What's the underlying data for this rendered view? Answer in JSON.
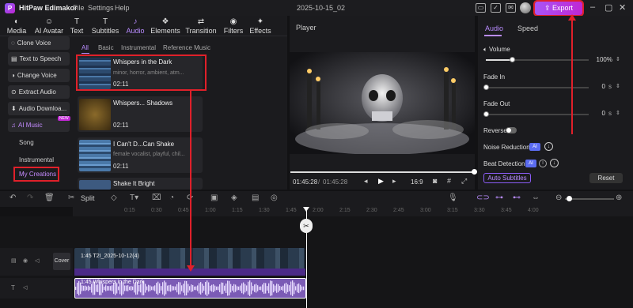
{
  "app": {
    "name": "HitPaw Edimakor",
    "menu": [
      "File",
      "Settings",
      "Help"
    ],
    "project_name": "2025-10-15_02",
    "export_label": "Export"
  },
  "top_tabs": [
    {
      "label": "Media",
      "icon": "◐"
    },
    {
      "label": "AI Avatar",
      "icon": "☺"
    },
    {
      "label": "Text",
      "icon": "T"
    },
    {
      "label": "Subtitles",
      "icon": "T"
    },
    {
      "label": "Audio",
      "icon": "♪"
    },
    {
      "label": "Elements",
      "icon": "❖"
    },
    {
      "label": "Transition",
      "icon": "⇄"
    },
    {
      "label": "Filters",
      "icon": "◉"
    },
    {
      "label": "Effects",
      "icon": "✦"
    }
  ],
  "sidebar": {
    "items": [
      "Clone Voice",
      "Text to Speech",
      "Change Voice",
      "Extract Audio",
      "Audio Downloa...",
      "AI Music"
    ],
    "ai_badge": "NEW",
    "subitems": [
      "Song",
      "Instrumental",
      "My Creations"
    ]
  },
  "filter_tabs": [
    "All",
    "Basic",
    "Instrumental",
    "Reference Music"
  ],
  "music_cards": [
    {
      "title": "Whispers in the Dark",
      "tags": "minor, horror, ambient, atm...",
      "duration": "02:11"
    },
    {
      "title": "Whispers... Shadows",
      "tags": "",
      "duration": "02:11"
    },
    {
      "title": "I Can't D...Can Shake",
      "tags": "female vocalist, playful, chil...",
      "duration": "02:11"
    },
    {
      "title": "Shake It Bright",
      "tags": "",
      "duration": ""
    }
  ],
  "player": {
    "label": "Player",
    "current": "01:45:28",
    "total": "01:45:28",
    "ratio": "16:9",
    "progress": 1.0
  },
  "right_panel": {
    "tabs": [
      "Audio",
      "Speed"
    ],
    "volume_label": "Volume",
    "volume_value": "100%",
    "volume_level": 0.25,
    "fade_in_label": "Fade In",
    "fade_in_value": "0",
    "fade_unit": "s",
    "fade_out_label": "Fade Out",
    "fade_out_value": "0",
    "reverse_label": "Reverse",
    "noise_label": "Noise Reduction",
    "beat_label": "Beat Detection",
    "ai_label": "AI",
    "auto_subtitles": "Auto Subtitles",
    "reset": "Reset"
  },
  "toolbar": {
    "split_label": "Split"
  },
  "ruler": [
    "0:15",
    "0:30",
    "0:45",
    "1:00",
    "1:15",
    "1:30",
    "1:45",
    "2:00",
    "2:15",
    "2:30",
    "2:45",
    "3:00",
    "3:15",
    "3:30",
    "3:45",
    "4:00"
  ],
  "timeline": {
    "cover_label": "Cover",
    "video_clip": "1:45  T2I_2025-10-12(4)",
    "audio_clip": "1:45  Whispers in the Dark"
  },
  "colors": {
    "accent": "#b98cff",
    "export_gradient_start": "#a855f7",
    "annotation": "#e0202a"
  }
}
